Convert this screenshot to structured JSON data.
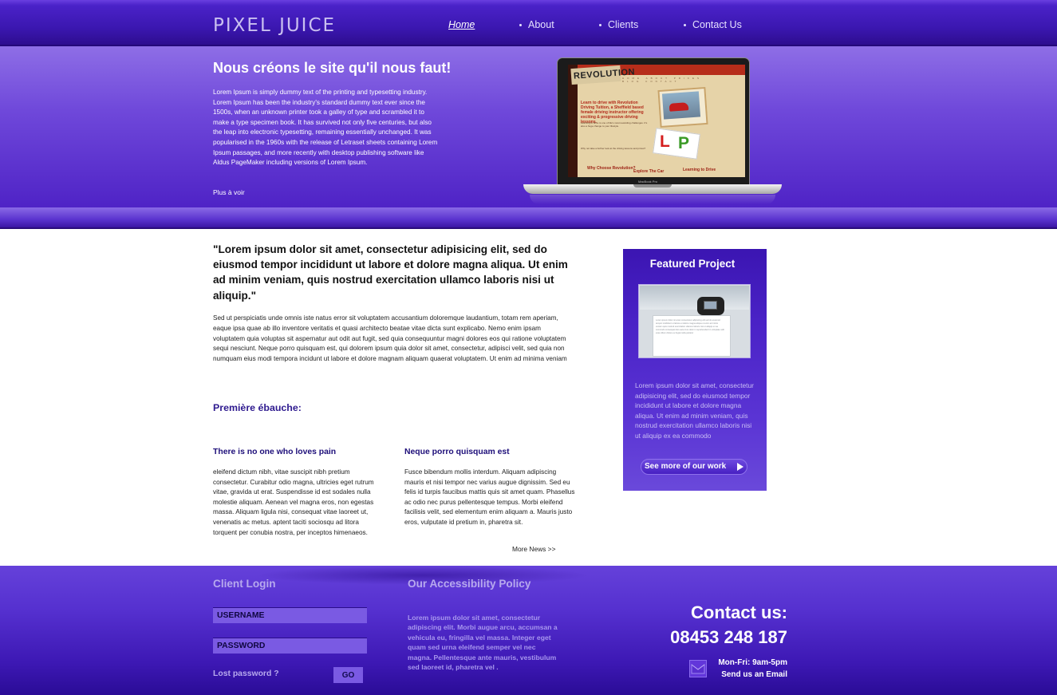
{
  "header": {
    "logo": "PIXEL JUICE",
    "nav": [
      "Home",
      "About",
      "Clients",
      "Contact Us"
    ]
  },
  "hero": {
    "title": "Nous créons le site qu'il nous faut!",
    "text": "Lorem Ipsum is simply dummy text of the printing and typesetting industry. Lorem Ipsum has been the industry's standard dummy text ever since the 1500s, when an unknown printer took a galley of type and scrambled it to make a type specimen book. It has survived not only five centuries, but also the leap into electronic typesetting, remaining essentially unchanged. It was popularised in the 1960s with the release of Letraset sheets containing Lorem Ipsum passages, and more recently with desktop publishing software like Aldus PageMaker including versions of Lorem Ipsum.",
    "more_link": "Plus à voir",
    "laptop": {
      "brand": "MacBook Pro",
      "screen_logo": "REVOLUTION",
      "screen_headline": "Learn to drive with Revolution Driving Tuition, a Sheffield based female driving instructor offering exciting & progressive driving lessons.",
      "screen_text_1": "Learning to drive is one of life's most rewarding challenges. It's also a huge change to your lifestyle.",
      "screen_text_2": "Why not take a further look at the driving lessons and prices?",
      "screen_link_1": "Why Choose Revolution?",
      "screen_link_2": "Explore The Car",
      "screen_link_3": "Learning to Drive",
      "screen_nav": "HOME ABOUT PRICES BLOG CONTACT",
      "plate_l": "L",
      "plate_p": "P"
    }
  },
  "main": {
    "quote": "\"Lorem ipsum dolor sit amet, consectetur adipisicing elit, sed do eiusmod tempor incididunt ut labore et dolore magna aliqua. Ut enim ad minim veniam, quis nostrud exercitation ullamco laboris nisi ut aliquip.\"",
    "paragraph": "Sed ut perspiciatis unde omnis iste natus error sit voluptatem accusantium doloremque laudantium, totam rem aperiam, eaque ipsa quae ab illo inventore veritatis et quasi architecto beatae vitae dicta sunt explicabo. Nemo enim ipsam voluptatem quia voluptas sit aspernatur aut odit aut fugit, sed quia consequuntur magni dolores eos qui ratione voluptatem sequi nesciunt. Neque porro quisquam est, qui dolorem ipsum quia dolor sit amet, consectetur, adipisci velit, sed quia non numquam eius modi tempora incidunt ut labore et dolore magnam aliquam quaerat voluptatem. Ut enim ad minima veniam",
    "draft_heading": "Première ébauche:",
    "col1": {
      "title": "There is no one who loves pain",
      "text": "eleifend dictum nibh, vitae suscipit nibh pretium consectetur. Curabitur odio magna, ultricies eget rutrum vitae, gravida ut erat. Suspendisse id est sodales nulla molestie aliquam. Aenean vel magna eros, non egestas massa. Aliquam ligula nisi, consequat vitae laoreet ut, venenatis ac metus. aptent taciti sociosqu ad litora torquent per conubia nostra, per inceptos himenaeos."
    },
    "col2": {
      "title": "Neque porro quisquam est",
      "text": "Fusce bibendum mollis interdum. Aliquam adipiscing mauris et nisi tempor nec varius augue dignissim. Sed eu felis id turpis faucibus mattis quis sit amet quam. Phasellus ac odio nec purus pellentesque tempus. Morbi eleifend facilisis velit, sed elementum enim aliquam a. Mauris justo eros, vulputate id pretium in, pharetra sit."
    },
    "more_news": "More News >>"
  },
  "featured": {
    "title": "Featured Project",
    "text": "Lorem ipsum dolor sit amet, consectetur adipisicing elit, sed do eiusmod tempor incididunt ut labore et dolore magna aliqua. Ut enim ad minim veniam, quis nostrud exercitation ullamco laboris nisi ut aliquip ex ea commodo",
    "button": "See more of our work",
    "image_lines": "Lorem ipsum dolor sit amet consectetur adipiscing elit sed do eiusmod tempor incididunt ut labore et dolore magna aliqua ut enim ad minim veniam quis nostrud exercitation ullamco laboris nisi ut aliquip ex ea commodo consequat duis aute irure dolor in reprehenderit in voluptate velit esse cillum dolore eu fugiat nulla pariatur"
  },
  "footer": {
    "login_title": "Client Login",
    "username_placeholder": "USERNAME",
    "password_placeholder": "PASSWORD",
    "lost_password": "Lost password ?",
    "go_button": "GO",
    "access_title": "Our Accessibility Policy",
    "access_text": "Lorem ipsum dolor sit amet, consectetur adipiscing elit. Morbi augue arcu, accumsan a vehicula eu, fringilla vel massa. Integer eget quam sed urna eleifend semper vel nec magna. Pellentesque ante mauris, vestibulum sed laoreet id, pharetra vel .",
    "contact_title": "Contact us:",
    "phone": "08453 248 187",
    "hours": "Mon-Fri: 9am-5pm",
    "email_link": "Send us an Email"
  },
  "colors": {
    "brand_purple": "#4a22c6",
    "accent_light": "#7a5ae3",
    "heading_navy": "#1e0f7a"
  }
}
